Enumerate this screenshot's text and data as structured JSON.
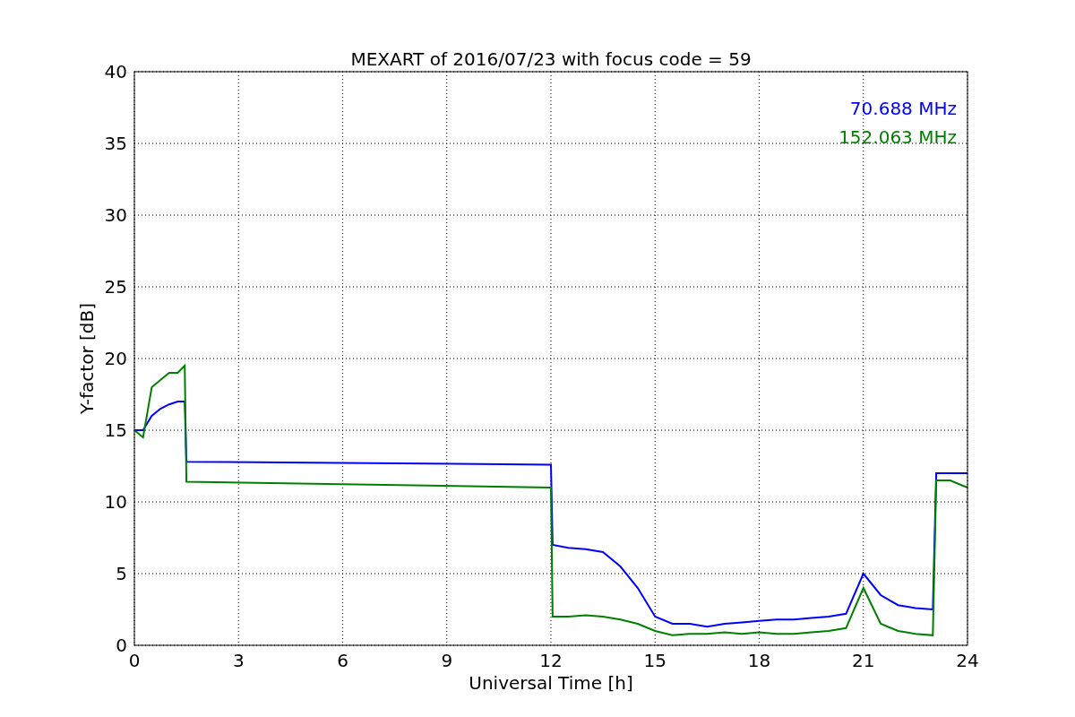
{
  "chart_data": {
    "type": "line",
    "title": "MEXART of 2016/07/23 with focus code = 59",
    "xlabel": "Universal Time [h]",
    "ylabel": "Y-factor [dB]",
    "x": [
      0,
      0.25,
      0.5,
      0.75,
      1,
      1.25,
      1.45,
      1.5,
      12,
      12.05,
      12.5,
      13,
      13.5,
      14,
      14.5,
      15,
      15.5,
      16,
      16.5,
      17,
      17.5,
      18,
      18.5,
      19,
      19.5,
      20,
      20.5,
      21,
      21.5,
      22,
      22.5,
      23,
      23.1,
      23.5,
      24
    ],
    "series": [
      {
        "name": "70.688 MHz",
        "color": "#0000ff",
        "values": [
          15,
          15,
          16,
          16.5,
          16.8,
          17,
          17,
          12.8,
          12.6,
          7,
          6.8,
          6.7,
          6.5,
          5.5,
          4,
          2,
          1.5,
          1.5,
          1.3,
          1.5,
          1.6,
          1.7,
          1.8,
          1.8,
          1.9,
          2,
          2.2,
          5,
          3.5,
          2.8,
          2.6,
          2.5,
          12,
          12,
          12
        ]
      },
      {
        "name": "152.063 MHz",
        "color": "#008000",
        "values": [
          15,
          14.5,
          18,
          18.5,
          19,
          19,
          19.5,
          11.4,
          11,
          2,
          2,
          2.1,
          2,
          1.8,
          1.5,
          1,
          0.7,
          0.8,
          0.8,
          0.9,
          0.8,
          0.9,
          0.8,
          0.8,
          0.9,
          1,
          1.2,
          4,
          1.5,
          1,
          0.8,
          0.7,
          11.5,
          11.5,
          11
        ]
      }
    ],
    "grid": true,
    "xlim": [
      0,
      24
    ],
    "ylim": [
      0,
      40
    ],
    "xticks": [
      0,
      3,
      6,
      9,
      12,
      15,
      18,
      21,
      24
    ],
    "yticks": [
      0,
      5,
      10,
      15,
      20,
      25,
      30,
      35,
      40
    ]
  }
}
